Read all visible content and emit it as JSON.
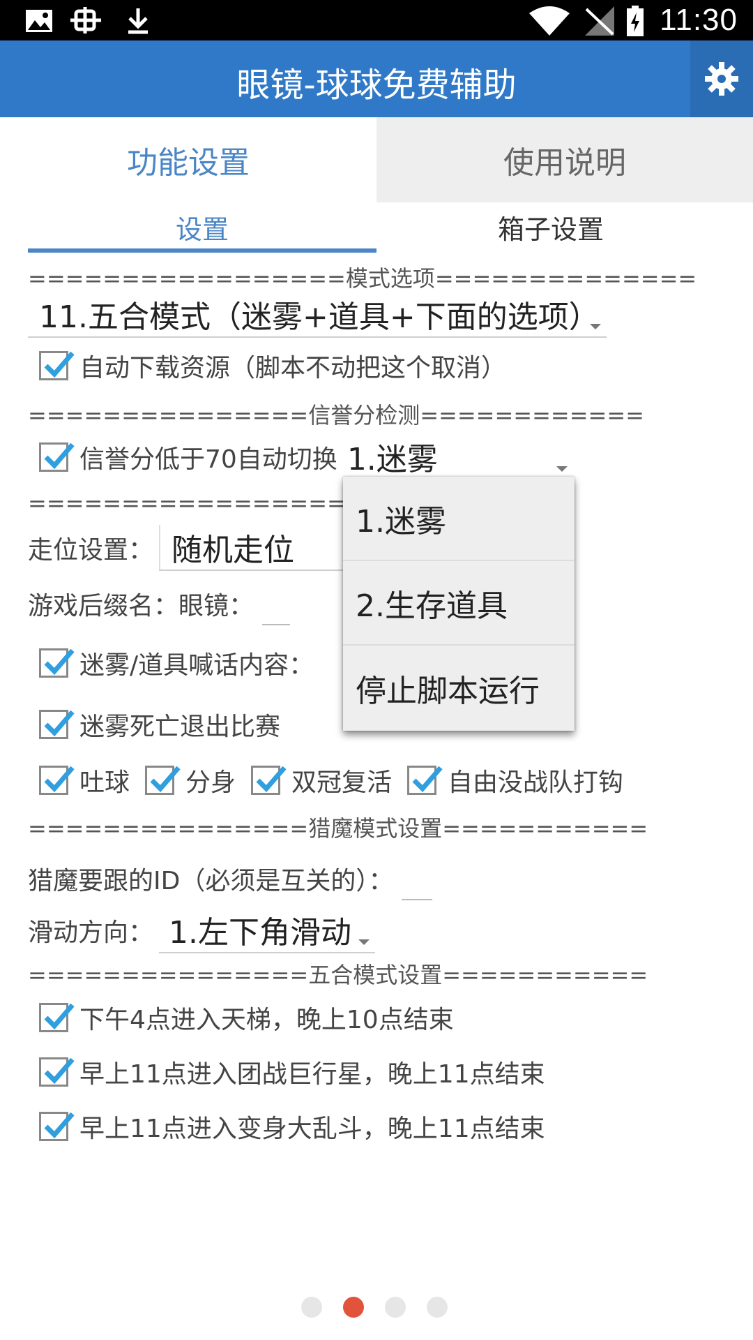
{
  "status_bar": {
    "time": "11:30",
    "icons": [
      "gallery-icon",
      "debug-icon",
      "download-icon",
      "wifi-icon",
      "signal-icon",
      "battery-icon"
    ]
  },
  "app_bar": {
    "title": "眼镜-球球免费辅助",
    "settings_icon": "gear-icon"
  },
  "main_tabs": [
    {
      "label": "功能设置",
      "active": true
    },
    {
      "label": "使用说明",
      "active": false
    }
  ],
  "sub_tabs": [
    {
      "label": "设置",
      "active": true
    },
    {
      "label": "箱子设置",
      "active": false
    }
  ],
  "sections": {
    "mode": "=================模式选项==============",
    "credit": "===============信誉分检测============",
    "other": "=================其他设置",
    "hunt": "===============猎魔模式设置===========",
    "five": "===============五合模式设置==========="
  },
  "mode_select": {
    "value": "11.五合模式（迷雾+道具+下面的选项）"
  },
  "auto_download": {
    "label": "自动下载资源（脚本不动把这个取消）",
    "checked": true
  },
  "credit_switch": {
    "label": "信誉分低于70自动切换",
    "checked": true,
    "value": "1.迷雾"
  },
  "credit_options": [
    "1.迷雾",
    "2.生存道具",
    "停止脚本运行"
  ],
  "walk_setting": {
    "label": "走位设置：",
    "value": "随机走位"
  },
  "game_suffix": {
    "label": "游戏后缀名：眼镜："
  },
  "chat_content": {
    "label": "迷雾/道具喊话内容：",
    "checked": true
  },
  "fog_death_exit": {
    "label": "迷雾死亡退出比赛",
    "checked": true
  },
  "toggles": [
    {
      "label": "吐球",
      "checked": true
    },
    {
      "label": "分身",
      "checked": true
    },
    {
      "label": "双冠复活",
      "checked": true
    },
    {
      "label": "自由没战队打钩",
      "checked": true
    }
  ],
  "hunt_id": {
    "label": "猎魔要跟的ID（必须是互关的）："
  },
  "swipe_direction": {
    "label": "滑动方向：",
    "value": "1.左下角滑动"
  },
  "five_mode_options": [
    {
      "label": "下午4点进入天梯，晚上10点结束",
      "checked": true
    },
    {
      "label": "早上11点进入团战巨行星，晚上11点结束",
      "checked": true
    },
    {
      "label": "早上11点进入变身大乱斗，晚上11点结束",
      "checked": true
    }
  ],
  "pager": {
    "count": 4,
    "active_index": 1
  },
  "colors": {
    "app_bar": "#2f79c8",
    "accent": "#4a86c6",
    "active_dot": "#e2533c"
  }
}
